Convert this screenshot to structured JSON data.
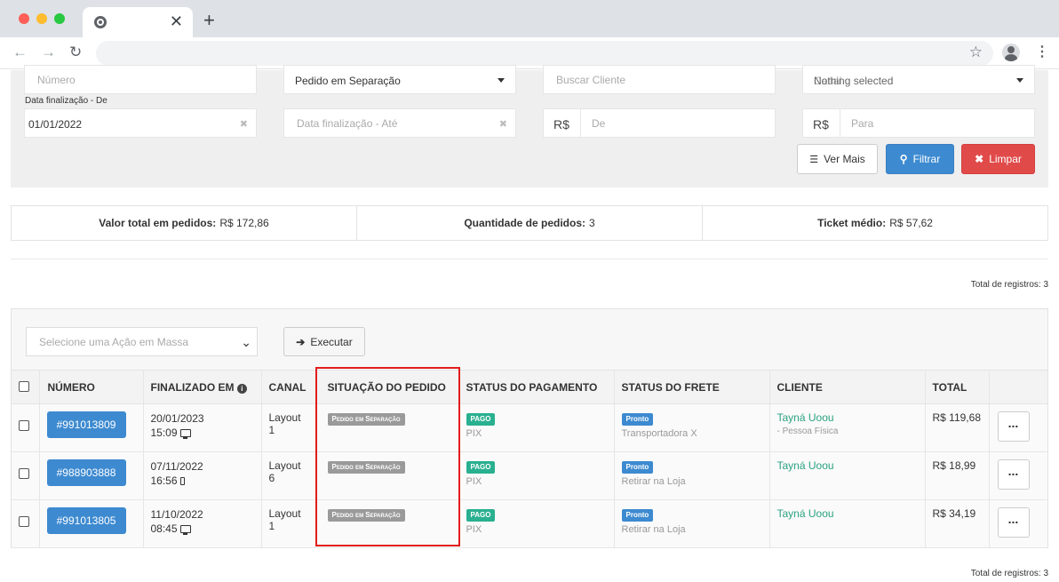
{
  "browser": {
    "tab_close": "✕",
    "new_tab": "+"
  },
  "filters": {
    "numero_placeholder": "Número",
    "situacao_value": "Pedido em Separação",
    "cliente_placeholder": "Buscar Cliente",
    "nothing_selected": "Nothing selected",
    "nothing_selected_overlay": "Canal",
    "data_de_label": "Data finalização - De",
    "data_de_value": "01/01/2022",
    "data_ate_placeholder": "Data finalização - Até",
    "currency": "R$",
    "de_placeholder": "De",
    "para_placeholder": "Para",
    "ver_mais": "Ver Mais",
    "filtrar": "Filtrar",
    "limpar": "Limpar"
  },
  "summary": {
    "valor_label": "Valor total em pedidos:",
    "valor_value": "R$ 172,86",
    "qtd_label": "Quantidade de pedidos:",
    "qtd_value": "3",
    "ticket_label": "Ticket médio:",
    "ticket_value": "R$ 57,62"
  },
  "total_registros": "Total de registros: 3",
  "mass_action": {
    "placeholder": "Selecione uma Ação em Massa",
    "executar": "Executar"
  },
  "table": {
    "headers": [
      "NÚMERO",
      "FINALIZADO EM",
      "CANAL",
      "SITUAÇÃO DO PEDIDO",
      "STATUS DO PAGAMENTO",
      "STATUS DO FRETE",
      "CLIENTE",
      "TOTAL"
    ],
    "rows": [
      {
        "numero": "#991013809",
        "data": "20/01/2023",
        "hora": "15:09",
        "canal": "Layout 1",
        "situacao": "Pedido em Separação",
        "pagamento": "PAGO",
        "metodo": "PIX",
        "frete": "Pronto",
        "frete_detalhe": "Transportadora X",
        "cliente": "Tayná Uoou",
        "cliente_tipo": "- Pessoa Física",
        "total": "R$ 119,68",
        "acoes": "..."
      },
      {
        "numero": "#988903888",
        "data": "07/11/2022",
        "hora": "16:56",
        "canal": "Layout 6",
        "situacao": "Pedido em Separação",
        "pagamento": "PAGO",
        "metodo": "PIX",
        "frete": "Pronto",
        "frete_detalhe": "Retirar na Loja",
        "cliente": "Tayná Uoou",
        "cliente_tipo": "",
        "total": "R$ 18,99",
        "acoes": "..."
      },
      {
        "numero": "#991013805",
        "data": "11/10/2022",
        "hora": "08:45",
        "canal": "Layout 1",
        "situacao": "Pedido em Separação",
        "pagamento": "PAGO",
        "metodo": "PIX",
        "frete": "Pronto",
        "frete_detalhe": "Retirar na Loja",
        "cliente": "Tayná Uoou",
        "cliente_tipo": "",
        "total": "R$ 34,19",
        "acoes": "..."
      }
    ]
  }
}
